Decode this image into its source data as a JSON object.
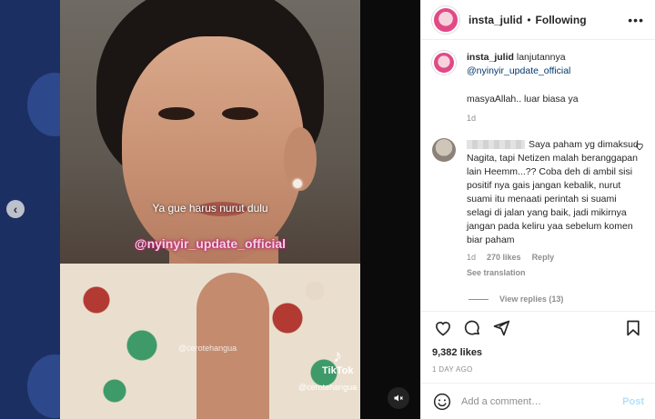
{
  "media": {
    "subtitle": "Ya gue harus nurut dulu",
    "watermark": "@nyinyir_update_official",
    "small_watermark": "@cerotehangua",
    "tiktok_label": "TikTok",
    "tiktok_handle": "@cerotehangua",
    "prev_icon": "‹",
    "mute_icon": "✕"
  },
  "header": {
    "username": "insta_julid",
    "separator": "•",
    "follow_status": "Following",
    "more_icon": "•••"
  },
  "caption": {
    "username": "insta_julid",
    "text": "lanjutannya",
    "mention": "@nyinyir_update_official",
    "paragraph": "masyaAllah.. luar biasa ya",
    "time": "1d"
  },
  "comment": {
    "text": "Saya paham yg dimaksud Nagita, tapi Netizen malah beranggapan lain Heemm...?? Coba deh di ambil sisi positif nya gais jangan kebalik, nurut suami itu menaati perintah si suami selagi di jalan yang baik, jadi mikirnya jangan pada keliru yaa sebelum komen biar paham",
    "time": "1d",
    "likes": "270 likes",
    "reply": "Reply",
    "translate": "See translation",
    "view_replies": "View replies (13)"
  },
  "post": {
    "likes": "9,382 likes",
    "date": "1 DAY AGO",
    "comment_placeholder": "Add a comment…",
    "post_label": "Post"
  }
}
